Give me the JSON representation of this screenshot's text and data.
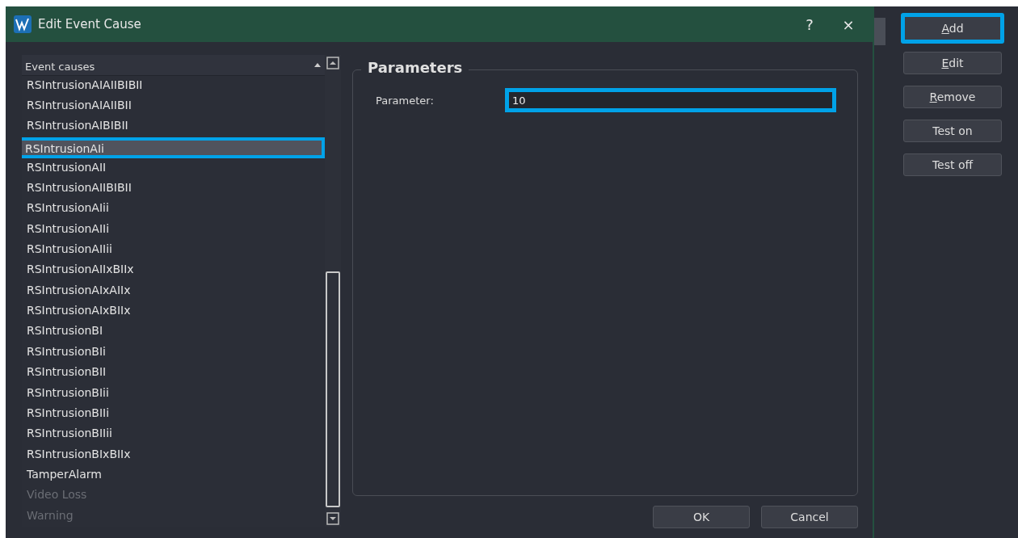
{
  "window": {
    "title": "Edit Event Cause",
    "help": "?",
    "close": "×"
  },
  "list": {
    "header": "Event causes",
    "items": [
      {
        "label": "RSIntrusionAIAIIBIBII",
        "selected": false,
        "disabled": false,
        "highlighted": false
      },
      {
        "label": "RSIntrusionAIAIIBII",
        "selected": false,
        "disabled": false,
        "highlighted": false
      },
      {
        "label": "RSIntrusionAIBIBII",
        "selected": false,
        "disabled": false,
        "highlighted": false
      },
      {
        "label": "RSIntrusionAIi",
        "selected": true,
        "disabled": false,
        "highlighted": true
      },
      {
        "label": "RSIntrusionAII",
        "selected": false,
        "disabled": false,
        "highlighted": false
      },
      {
        "label": "RSIntrusionAIIBIBII",
        "selected": false,
        "disabled": false,
        "highlighted": false
      },
      {
        "label": "RSIntrusionAIii",
        "selected": false,
        "disabled": false,
        "highlighted": false
      },
      {
        "label": "RSIntrusionAIIi",
        "selected": false,
        "disabled": false,
        "highlighted": false
      },
      {
        "label": "RSIntrusionAIIii",
        "selected": false,
        "disabled": false,
        "highlighted": false
      },
      {
        "label": "RSIntrusionAIIxBIIx",
        "selected": false,
        "disabled": false,
        "highlighted": false
      },
      {
        "label": "RSIntrusionAIxAIIx",
        "selected": false,
        "disabled": false,
        "highlighted": false
      },
      {
        "label": "RSIntrusionAIxBIIx",
        "selected": false,
        "disabled": false,
        "highlighted": false
      },
      {
        "label": "RSIntrusionBI",
        "selected": false,
        "disabled": false,
        "highlighted": false
      },
      {
        "label": "RSIntrusionBIi",
        "selected": false,
        "disabled": false,
        "highlighted": false
      },
      {
        "label": "RSIntrusionBII",
        "selected": false,
        "disabled": false,
        "highlighted": false
      },
      {
        "label": "RSIntrusionBIii",
        "selected": false,
        "disabled": false,
        "highlighted": false
      },
      {
        "label": "RSIntrusionBIIi",
        "selected": false,
        "disabled": false,
        "highlighted": false
      },
      {
        "label": "RSIntrusionBIIii",
        "selected": false,
        "disabled": false,
        "highlighted": false
      },
      {
        "label": "RSIntrusionBIxBIIx",
        "selected": false,
        "disabled": false,
        "highlighted": false
      },
      {
        "label": "TamperAlarm",
        "selected": false,
        "disabled": false,
        "highlighted": false
      },
      {
        "label": "Video Loss",
        "selected": false,
        "disabled": true,
        "highlighted": false
      },
      {
        "label": "Warning",
        "selected": false,
        "disabled": true,
        "highlighted": false
      }
    ]
  },
  "parameters": {
    "title": "Parameters",
    "label": "Parameter:",
    "value": "10",
    "highlighted": true
  },
  "dialog_buttons": [
    "OK",
    "Cancel"
  ],
  "side_buttons": [
    {
      "label": "Add",
      "underline_first": true,
      "highlighted": true
    },
    {
      "label": "Edit",
      "underline_first": true,
      "highlighted": false
    },
    {
      "label": "Remove",
      "underline_first": true,
      "highlighted": false
    },
    {
      "label": "Test on",
      "underline_first": false,
      "highlighted": false
    },
    {
      "label": "Test off",
      "underline_first": false,
      "highlighted": false
    }
  ]
}
